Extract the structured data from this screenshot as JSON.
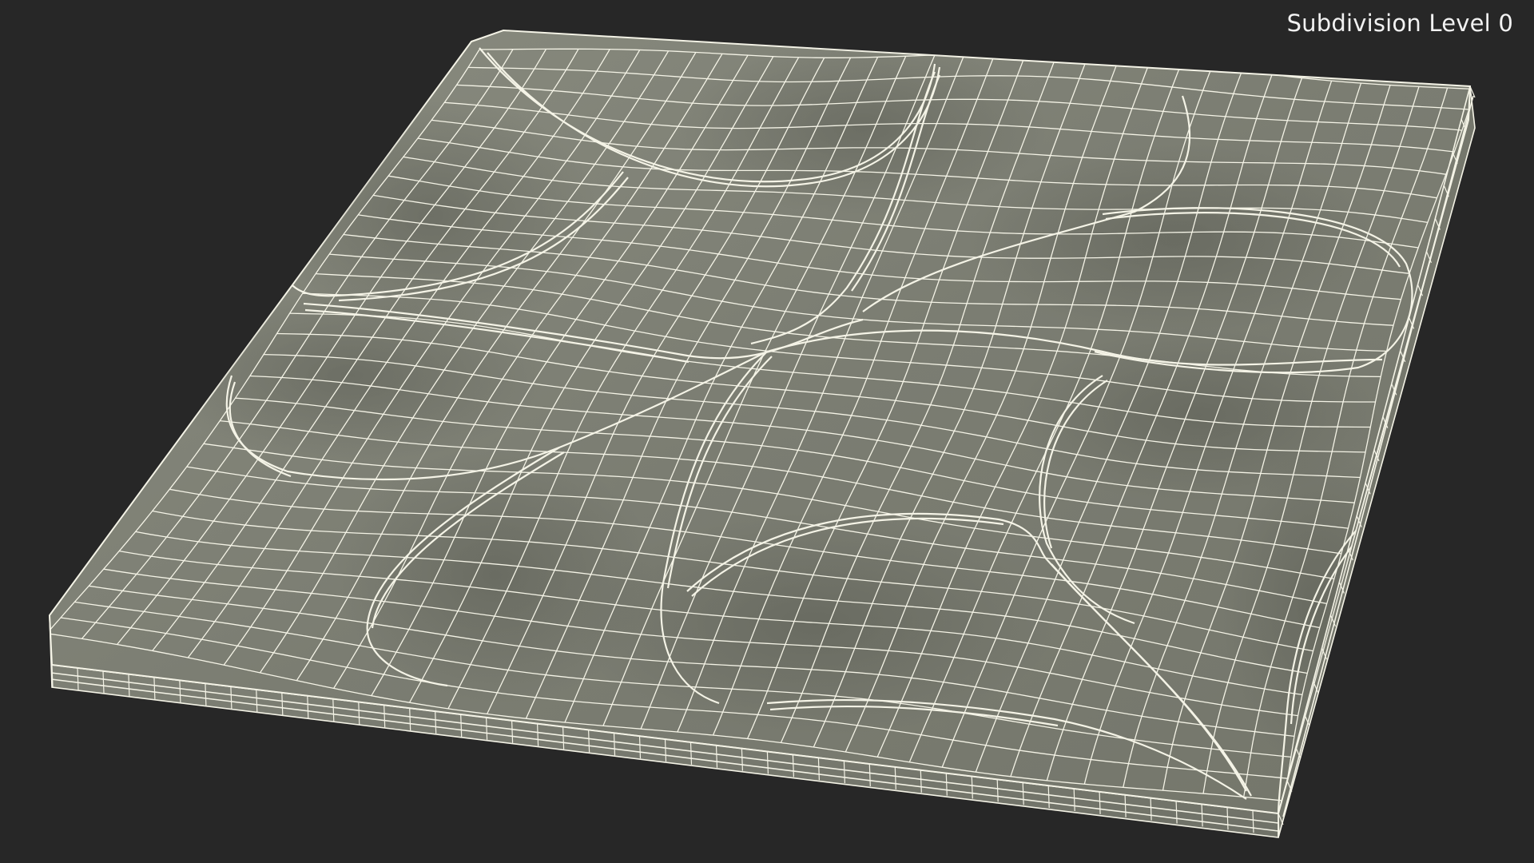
{
  "viewport": {
    "subdivision_label": "Subdivision Level 0"
  },
  "colors": {
    "background": "#272727",
    "surface_light": "#888a7e",
    "surface_mid": "#797b70",
    "surface_dark": "#5d5f56",
    "wire": "#f4f3e6"
  },
  "model": {
    "description_icon": "wireframe-tile-model"
  }
}
